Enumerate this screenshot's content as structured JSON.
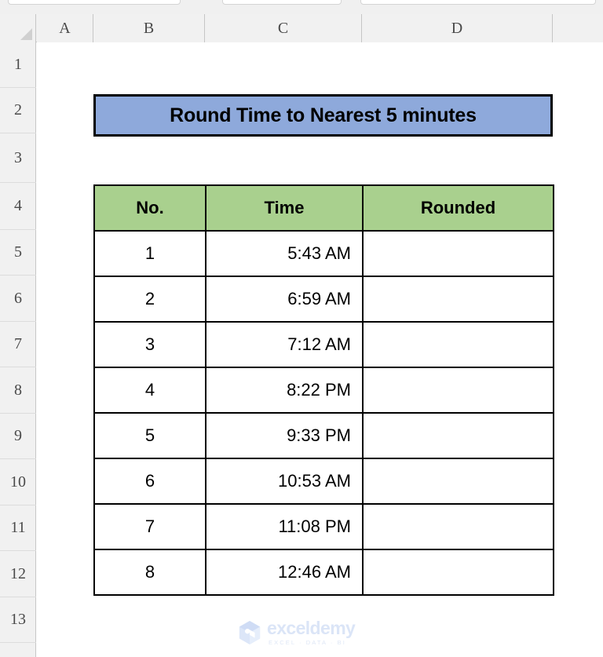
{
  "app": {
    "type": "spreadsheet",
    "colors": {
      "title_banner_fill": "#8EA9DB",
      "table_header_fill": "#A9D08E",
      "cell_fill": "#FFFFFF",
      "border": "#000000",
      "header_band": "#F1F1F1",
      "gridline": "#DCDCDC"
    }
  },
  "grid": {
    "column_headers": [
      "A",
      "B",
      "C",
      "D"
    ],
    "row_headers": [
      "1",
      "2",
      "3",
      "4",
      "5",
      "6",
      "7",
      "8",
      "9",
      "10",
      "11",
      "12",
      "13"
    ],
    "select_all_name": "select-all-corner"
  },
  "title": {
    "text": "Round Time to Nearest 5 minutes"
  },
  "table": {
    "headers": [
      "No.",
      "Time",
      "Rounded"
    ],
    "rows": [
      {
        "no": "1",
        "time": "5:43 AM",
        "rounded": ""
      },
      {
        "no": "2",
        "time": "6:59 AM",
        "rounded": ""
      },
      {
        "no": "3",
        "time": "7:12 AM",
        "rounded": ""
      },
      {
        "no": "4",
        "time": "8:22 PM",
        "rounded": ""
      },
      {
        "no": "5",
        "time": "9:33 PM",
        "rounded": ""
      },
      {
        "no": "6",
        "time": "10:53 AM",
        "rounded": ""
      },
      {
        "no": "7",
        "time": "11:08 PM",
        "rounded": ""
      },
      {
        "no": "8",
        "time": "12:46 AM",
        "rounded": ""
      }
    ]
  },
  "watermark": {
    "name": "exceldemy",
    "tagline": "EXCEL · DATA · BI",
    "logo_icon": "cube-hexagon-icon"
  }
}
